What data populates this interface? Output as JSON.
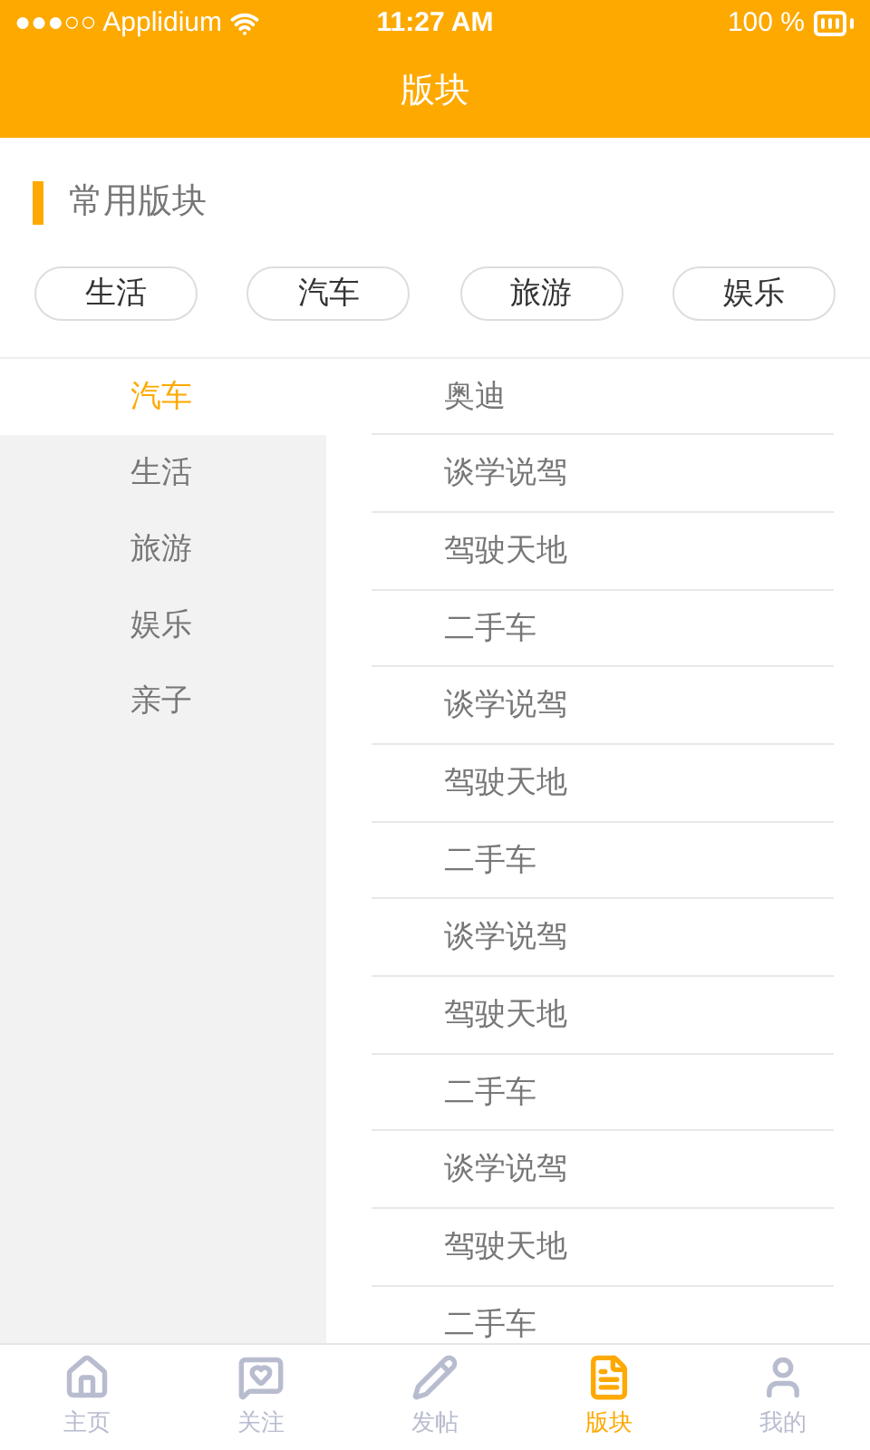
{
  "status_bar": {
    "carrier": "●●●○○ Applidium",
    "time": "11:27 AM",
    "battery": "100 %"
  },
  "header": {
    "title": "版块"
  },
  "favorites": {
    "title": "常用版块",
    "chips": [
      "生活",
      "汽车",
      "旅游",
      "娱乐"
    ]
  },
  "categories": [
    {
      "label": "汽车",
      "selected": true
    },
    {
      "label": "生活",
      "selected": false
    },
    {
      "label": "旅游",
      "selected": false
    },
    {
      "label": "娱乐",
      "selected": false
    },
    {
      "label": "亲子",
      "selected": false
    }
  ],
  "boards": [
    "奥迪",
    "谈学说驾",
    "驾驶天地",
    "二手车",
    "谈学说驾",
    "驾驶天地",
    "二手车",
    "谈学说驾",
    "驾驶天地",
    "二手车",
    "谈学说驾",
    "驾驶天地",
    "二手车"
  ],
  "tab_bar": [
    {
      "label": "主页",
      "kind": "home",
      "selected": false
    },
    {
      "label": "关注",
      "kind": "follow",
      "selected": false
    },
    {
      "label": "发帖",
      "kind": "post",
      "selected": false
    },
    {
      "label": "版块",
      "kind": "boards",
      "selected": true
    },
    {
      "label": "我的",
      "kind": "me",
      "selected": false
    }
  ]
}
